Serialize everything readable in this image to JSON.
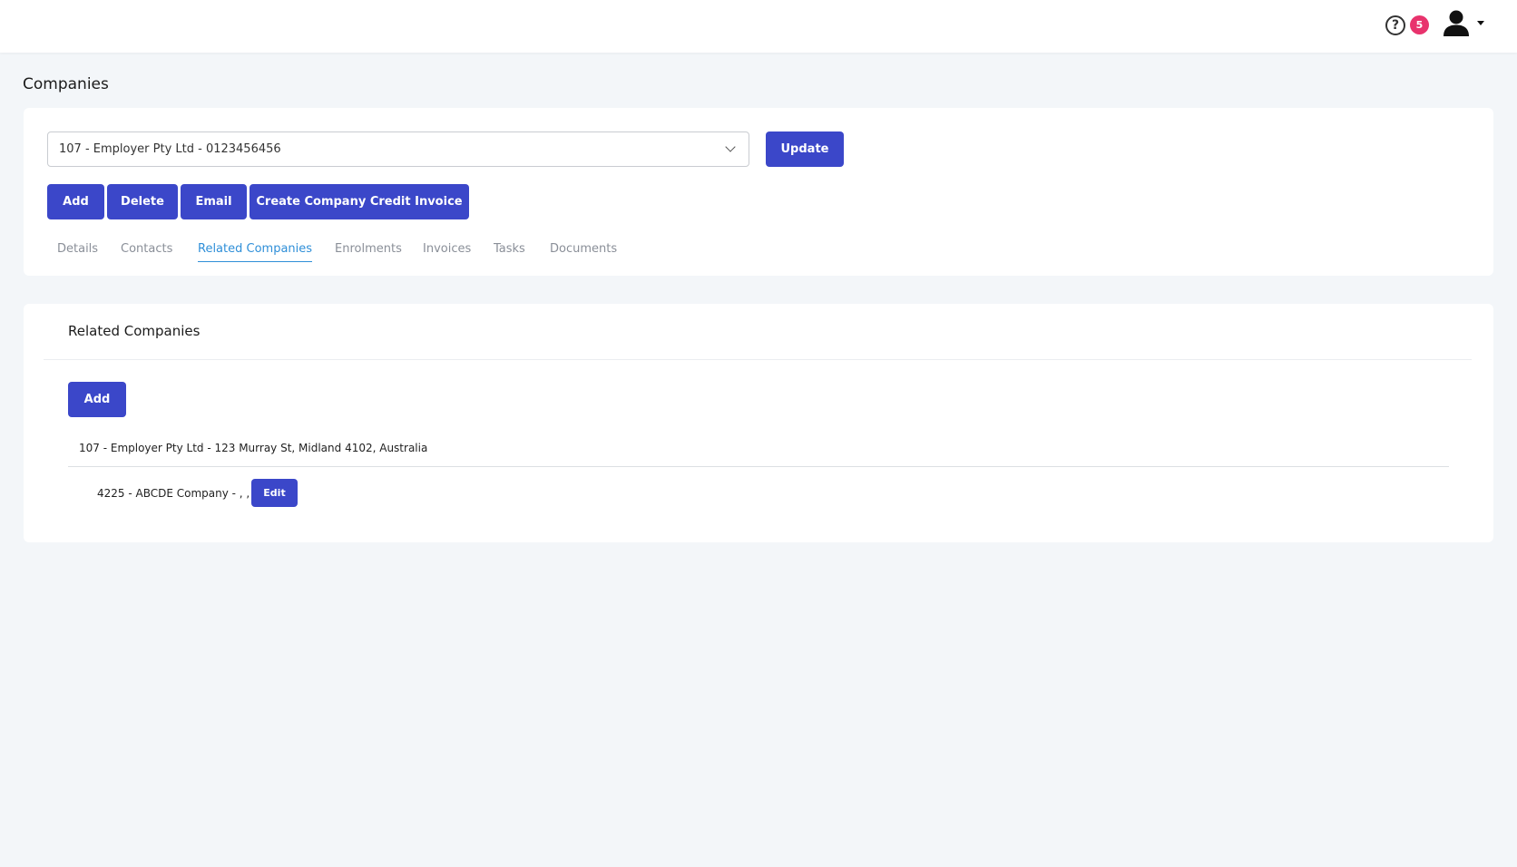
{
  "header": {
    "help_icon_glyph": "?",
    "notification_count": "5",
    "icons": [
      "help-icon",
      "user-icon",
      "caret-down-icon"
    ]
  },
  "page": {
    "title": "Companies"
  },
  "company_selector": {
    "selected_value": "107 - Employer Pty Ltd - 0123456456"
  },
  "toolbar": {
    "update_label": "Update",
    "add_label": "Add",
    "delete_label": "Delete",
    "email_label": "Email",
    "credit_invoice_label": "Create Company Credit Invoice"
  },
  "tabs": [
    {
      "label": "Details"
    },
    {
      "label": "Contacts"
    },
    {
      "label": "Related Companies",
      "active": true
    },
    {
      "label": "Enrolments"
    },
    {
      "label": "Invoices"
    },
    {
      "label": "Tasks"
    },
    {
      "label": "Documents"
    }
  ],
  "related_companies": {
    "title": "Related Companies",
    "add_label": "Add",
    "parent": "107 - Employer Pty Ltd - 123 Murray St, Midland 4102, Australia",
    "children": [
      {
        "label": "4225 - ABCDE Company - , ,",
        "edit_label": "Edit"
      }
    ]
  },
  "colors": {
    "primary": "#3b47c9",
    "active_tab": "#2f8fd8",
    "badge": "#e8336d",
    "background": "#f3f6f9"
  }
}
